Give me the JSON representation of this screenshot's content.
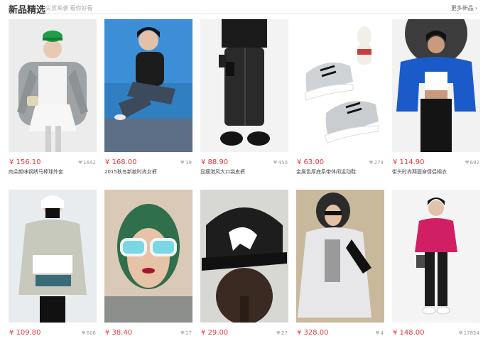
{
  "header": {
    "title": "新品精选",
    "subtitle": "尖货来袭 看你好看",
    "more_label": "更多新品",
    "more_icon": "chevron-right-icon"
  },
  "colors": {
    "price": "#e4393c",
    "divider": "#e6e6e6",
    "muted": "#999999"
  },
  "products": [
    {
      "price": "¥ 156.10",
      "likes": "1642",
      "title": "肉朵颜味钢绣马棒球外套"
    },
    {
      "price": "¥ 168.00",
      "likes": "19",
      "title": "2015秋冬新款时尚女裤"
    },
    {
      "price": "¥ 88.90",
      "likes": "450",
      "title": "显瘦港风大口袋皮裤"
    },
    {
      "price": "¥ 63.00",
      "likes": "279",
      "title": "金属色厚底系带休闲运动鞋"
    },
    {
      "price": "¥ 114.90",
      "likes": "692",
      "title": "街头时尚两面穿情侣棉衣"
    },
    {
      "price": "¥ 109.80",
      "likes": "606",
      "title": ""
    },
    {
      "price": "¥ 38.40",
      "likes": "17",
      "title": ""
    },
    {
      "price": "¥ 29.00",
      "likes": "27",
      "title": ""
    },
    {
      "price": "¥ 328.00",
      "likes": "4",
      "title": ""
    },
    {
      "price": "¥ 148.00",
      "likes": "17824",
      "title": ""
    }
  ]
}
